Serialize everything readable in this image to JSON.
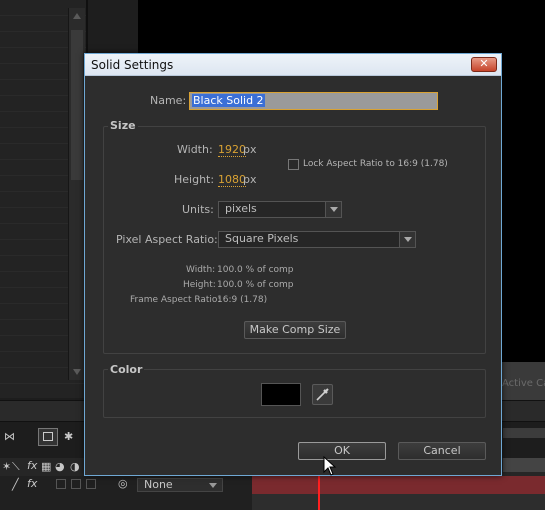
{
  "background": {
    "viewer_label": "Active Ca",
    "layer_dropdown": "None",
    "fx_label": "fx"
  },
  "dialog": {
    "title": "Solid Settings",
    "close_glyph": "✕",
    "name_label": "Name:",
    "name_value": "Black Solid 2",
    "size_group": {
      "title": "Size",
      "width_label": "Width:",
      "width_value": "1920",
      "width_unit": "px",
      "height_label": "Height:",
      "height_value": "1080",
      "height_unit": "px",
      "lock_aspect_label": "Lock Aspect Ratio to 16:9 (1.78)",
      "lock_aspect_checked": false,
      "units_label": "Units:",
      "units_value": "pixels",
      "par_label": "Pixel Aspect Ratio:",
      "par_value": "Square Pixels",
      "info": {
        "width_label": "Width:",
        "width_value": "100.0 % of comp",
        "height_label": "Height:",
        "height_value": "100.0 % of comp",
        "far_label": "Frame Aspect Ratio:",
        "far_value": "16:9 (1.78)"
      },
      "make_comp_size_label": "Make Comp Size"
    },
    "color_group": {
      "title": "Color",
      "swatch_color": "#000000"
    },
    "ok_label": "OK",
    "cancel_label": "Cancel"
  }
}
